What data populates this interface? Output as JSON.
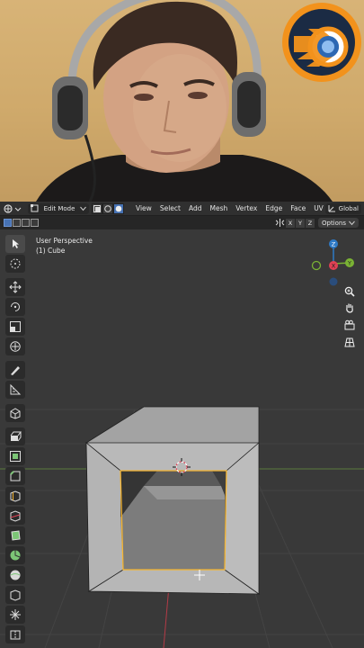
{
  "header": {
    "mode": "Edit Mode",
    "menus": [
      "View",
      "Select",
      "Add",
      "Mesh",
      "Vertex",
      "Edge",
      "Face",
      "UV"
    ],
    "orientation": "Global"
  },
  "header2": {
    "axes": [
      "X",
      "Y",
      "Z"
    ],
    "options": "Options"
  },
  "viewport": {
    "view_name": "User Perspective",
    "object_name": "(1) Cube"
  },
  "gizmo": {
    "z_label": "Z",
    "y_label": "Y",
    "x_label": "X"
  },
  "icons": {
    "logo": "blender-logo-icon",
    "tools": [
      "select-box-icon",
      "cursor-icon",
      "move-icon",
      "rotate-icon",
      "scale-icon",
      "transform-icon",
      "annotate-icon",
      "measure-icon",
      "add-cube-icon",
      "extrude-icon",
      "inset-icon",
      "bevel-icon",
      "loop-cut-icon",
      "knife-icon",
      "poly-build-icon",
      "spin-icon",
      "smooth-icon",
      "edge-slide-icon",
      "shrink-fatten-icon",
      "shear-icon",
      "rip-icon"
    ],
    "nav": [
      "zoom-icon",
      "hand-pan-icon",
      "camera-icon",
      "grid-icon"
    ]
  },
  "colors": {
    "accent": "#4772b3",
    "selection": "#f5b531",
    "axis_x": "#e04154",
    "axis_y": "#7ab234",
    "axis_z": "#2e7ac6"
  }
}
